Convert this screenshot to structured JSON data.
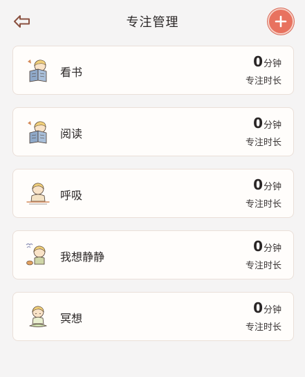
{
  "header": {
    "title": "专注管理",
    "back_icon": "back-arrow-icon",
    "add_icon": "plus-icon",
    "accent_color": "#e8725f"
  },
  "activities": [
    {
      "label": "看书",
      "value": "0",
      "unit": "分钟",
      "caption": "专注时长",
      "icon": "reading-character-icon"
    },
    {
      "label": "阅读",
      "value": "0",
      "unit": "分钟",
      "caption": "专注时长",
      "icon": "reading-character-icon"
    },
    {
      "label": "呼吸",
      "value": "0",
      "unit": "分钟",
      "caption": "专注时长",
      "icon": "breathing-character-icon"
    },
    {
      "label": "我想静静",
      "value": "0",
      "unit": "分钟",
      "caption": "专注时长",
      "icon": "quiet-character-icon"
    },
    {
      "label": "冥想",
      "value": "0",
      "unit": "分钟",
      "caption": "专注时长",
      "icon": "meditation-character-icon"
    }
  ]
}
